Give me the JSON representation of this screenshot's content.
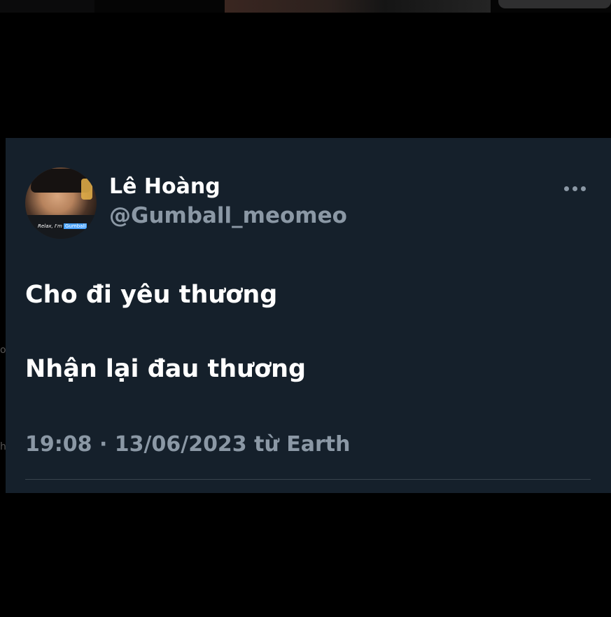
{
  "tweet": {
    "author": {
      "display_name": "Lê Hoàng",
      "handle": "@Gumball_meomeo",
      "avatar_caption_prefix": "Relax, I'm",
      "avatar_caption_tag": "Gumball"
    },
    "lines": [
      "Cho đi yêu thương",
      "Nhận lại đau thương"
    ],
    "timestamp": "19:08 · 13/06/2023 từ Earth",
    "more_icon": "more-horizontal-icon"
  },
  "background_edge": {
    "left_text_1": "o",
    "left_text_2": "h"
  },
  "colors": {
    "card_background": "#15202b",
    "secondary_text": "#8b98a5",
    "primary_text": "#ffffff",
    "page_background": "#000000",
    "divider": "#38444d"
  }
}
